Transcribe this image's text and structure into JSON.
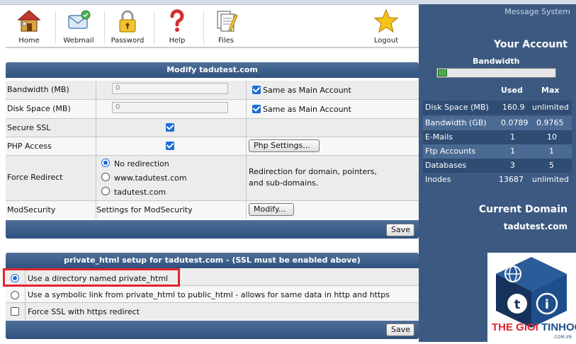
{
  "toolbar": {
    "items": [
      {
        "label": "Home",
        "icon": "home-icon"
      },
      {
        "label": "Webmail",
        "icon": "webmail-icon"
      },
      {
        "label": "Password",
        "icon": "lock-icon"
      },
      {
        "label": "Help",
        "icon": "help-icon"
      },
      {
        "label": "Files",
        "icon": "files-icon"
      },
      {
        "label": "Logout",
        "icon": "star-icon"
      }
    ]
  },
  "modify": {
    "title": "Modify tadutest.com",
    "bandwidth_label": "Bandwidth (MB)",
    "bandwidth_value": "0",
    "diskspace_label": "Disk Space (MB)",
    "diskspace_value": "0",
    "same_as_main": "Same as Main Account",
    "ssl_label": "Secure SSL",
    "php_label": "PHP Access",
    "php_settings_button": "Php Settings...",
    "redirect_label": "Force Redirect",
    "redirect_options": [
      "No redirection",
      "www.tadutest.com",
      "tadutest.com"
    ],
    "redirect_help_1": "Redirection for domain, pointers,",
    "redirect_help_2": "and sub-domains.",
    "modsec_label": "ModSecurity",
    "modsec_text": "Settings for ModSecurity",
    "modsec_button": "Modify...",
    "save_label": "Save"
  },
  "private": {
    "title": "private_html setup for tadutest.com - (SSL must be enabled above)",
    "options": [
      "Use a directory named private_html",
      "Use a symbolic link from private_html to public_html - allows for same data in http and https"
    ],
    "force_ssl": "Force SSL with https redirect",
    "save_label": "Save"
  },
  "sidebar": {
    "message_system": "Message System",
    "your_account": "Your Account",
    "bandwidth_title": "Bandwidth",
    "bandwidth_usage_fraction": 0.08,
    "col_used": "Used",
    "col_max": "Max",
    "rows": [
      {
        "label": "Disk Space (MB)",
        "used": "160.9",
        "max": "unlimited"
      },
      {
        "label": "Bandwidth (GB)",
        "used": "0.0789",
        "max": "0.9765"
      },
      {
        "label": "E-Mails",
        "used": "1",
        "max": "10"
      },
      {
        "label": "Ftp Accounts",
        "used": "1",
        "max": "1"
      },
      {
        "label": "Databases",
        "used": "3",
        "max": "5"
      },
      {
        "label": "Inodes",
        "used": "13687",
        "max": "unlimited"
      }
    ],
    "current_domain_title": "Current Domain",
    "current_domain": "tadutest.com"
  },
  "logo": {
    "text_the_gioi": "THE GIOI",
    "text_tinhoc": "TINHOC",
    "text_suffix": ".COM.VN",
    "colors": {
      "red": "#e0242b",
      "blue": "#1f4e8c",
      "navy": "#16325c"
    }
  }
}
